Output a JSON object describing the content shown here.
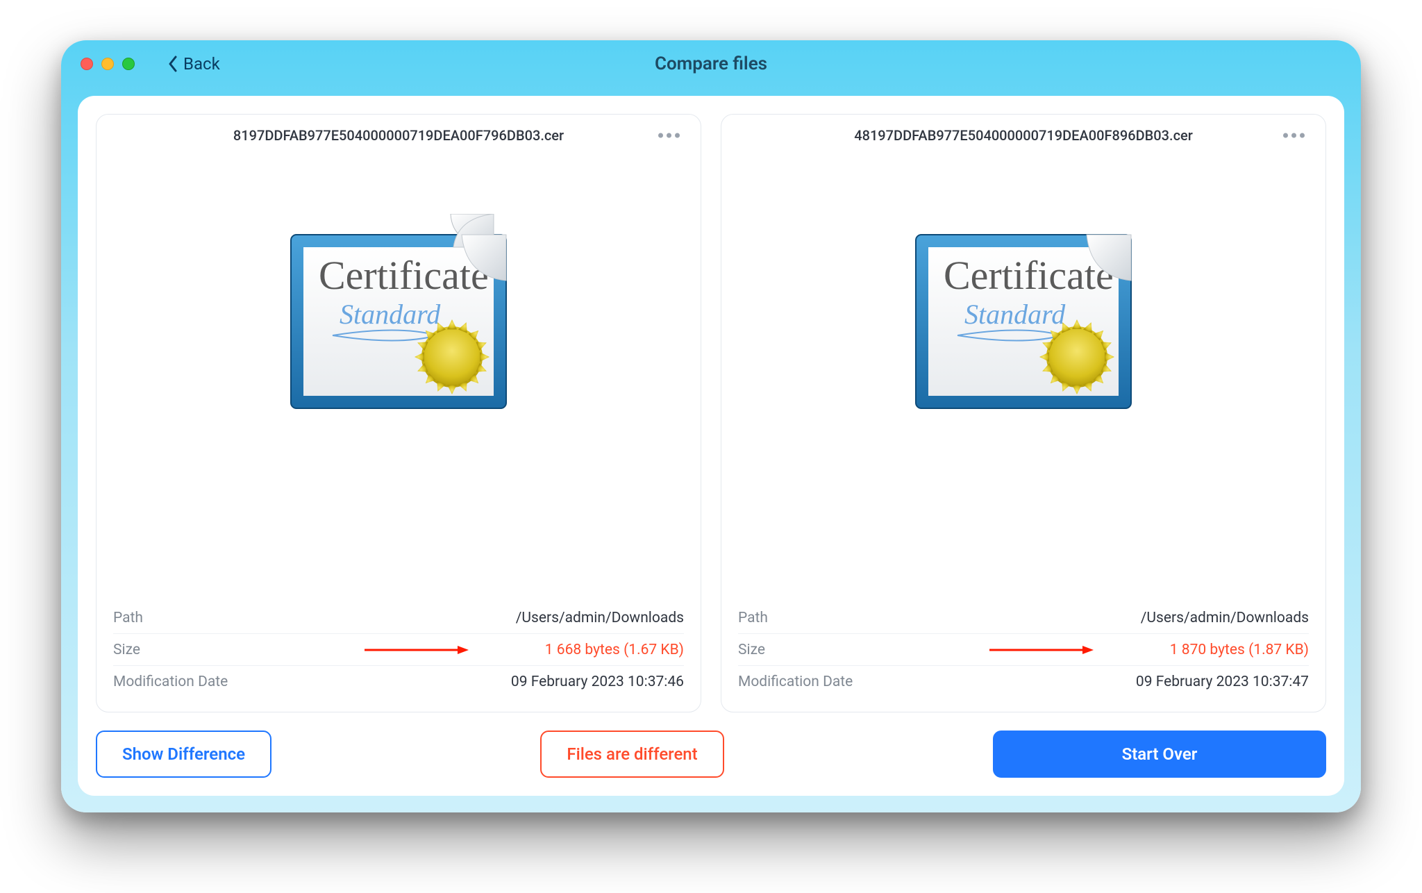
{
  "window": {
    "title": "Compare files",
    "back_label": "Back"
  },
  "files": [
    {
      "name": "8197DDFAB977E504000000719DEA00F796DB03.cer",
      "path_label": "Path",
      "path_value": "/Users/admin/Downloads",
      "size_label": "Size",
      "size_value": "1 668 bytes (1.67 KB)",
      "mod_label": "Modification Date",
      "mod_value": "09 February 2023 10:37:46",
      "icon_certificate_word": "Certificate",
      "icon_standard_word": "Standard"
    },
    {
      "name": "48197DDFAB977E504000000719DEA00F896DB03.cer",
      "path_label": "Path",
      "path_value": "/Users/admin/Downloads",
      "size_label": "Size",
      "size_value": "1 870 bytes (1.87 KB)",
      "mod_label": "Modification Date",
      "mod_value": "09 February 2023 10:37:47",
      "icon_certificate_word": "Certificate",
      "icon_standard_word": "Standard"
    }
  ],
  "actions": {
    "show_difference": "Show Difference",
    "status": "Files are different",
    "start_over": "Start Over"
  },
  "colors": {
    "accent_blue": "#1f77ff",
    "accent_red": "#ff4b2b"
  }
}
